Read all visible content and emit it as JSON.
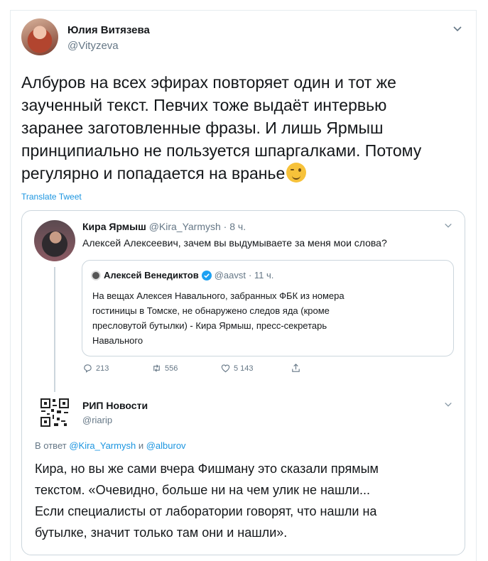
{
  "main_tweet": {
    "author_name": "Юлия Витязева",
    "author_handle": "@Vityzeva",
    "text_lines": [
      "Албуров на всех эфирах повторяет один и тот же",
      "заученный текст. Певчих тоже выдаёт интервью",
      "заранее заготовленные фразы. И лишь Ярмыш",
      "принципиально не пользуется шпаргалками. Потому",
      "регулярно и попадается на вранье"
    ],
    "emoji": "😉",
    "translate_label": "Translate Tweet"
  },
  "quoted_tweet": {
    "author_name": "Кира Ярмыш",
    "author_handle": "@Kira_Yarmysh",
    "time": "· 8 ч.",
    "text": "Алексей Алексеевич, зачем вы выдумываете за меня мои слова?",
    "inner": {
      "author_name": "Алексей Венедиктов",
      "author_handle": "@aavst",
      "time": "· 11 ч.",
      "text_lines": [
        "На вещах Алексея Навального, забранных ФБК из номера",
        "гостиницы в Томске, не обнаружено следов яда (кроме",
        "пресловутой бутылки) - Кира Ярмыш, пресс-секретарь",
        "Навального"
      ]
    },
    "actions": {
      "replies": "213",
      "retweets": "556",
      "likes": "5 143"
    }
  },
  "reply_tweet": {
    "author_name": "РИП Новости",
    "author_handle": "@riarip",
    "reply_prefix": "В ответ",
    "reply_to_1": "@Kira_Yarmysh",
    "reply_and": "и",
    "reply_to_2": "@alburov",
    "text_lines": [
      "Кира, но вы же сами вчера Фишману это сказали прямым",
      "текстом. «Очевидно, больше ни на чем улик не нашли...",
      "Если специалисты от лаборатории говорят, что нашли на",
      "бутылке, значит только там они и нашли»."
    ]
  },
  "colors": {
    "link": "#1b95e0",
    "muted": "#657786",
    "verified": "#1da1f2",
    "border": "#ccd6dd"
  }
}
